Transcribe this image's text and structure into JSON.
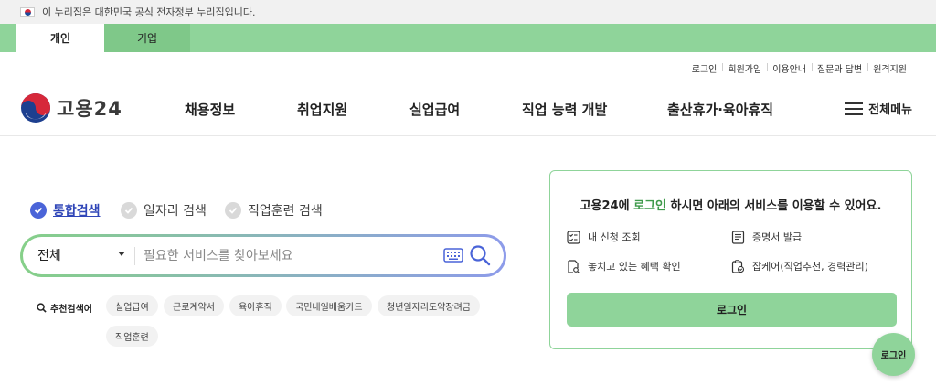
{
  "gov_banner": {
    "text": "이 누리집은 대한민국 공식 전자정부 누리집입니다."
  },
  "tabs": [
    {
      "label": "개인",
      "active": true
    },
    {
      "label": "기업",
      "active": false
    }
  ],
  "utility_links": [
    "로그인",
    "회원가입",
    "이용안내",
    "질문과 답변",
    "원격지원"
  ],
  "logo": {
    "text": "고용24"
  },
  "nav": [
    "채용정보",
    "취업지원",
    "실업급여",
    "직업 능력 개발",
    "출산휴가·육아휴직"
  ],
  "menu_all": {
    "label": "전체메뉴"
  },
  "search": {
    "types": [
      {
        "label": "통합검색",
        "selected": true
      },
      {
        "label": "일자리 검색",
        "selected": false
      },
      {
        "label": "직업훈련 검색",
        "selected": false
      }
    ],
    "scope": "전체",
    "placeholder": "필요한 서비스를 찾아보세요",
    "recommended_label": "추천검색어",
    "recommended": [
      "실업급여",
      "근로계약서",
      "육아휴직",
      "국민내일배움카드",
      "청년일자리도약장려금",
      "직업훈련"
    ]
  },
  "login_card": {
    "msg_prefix": "고용24에 ",
    "msg_highlight": "로그인",
    "msg_suffix": " 하시면 아래의 서비스를 이용할 수 있어요.",
    "services": [
      "내 신청 조회",
      "증명서 발급",
      "놓치고 있는 혜택 확인",
      "잡케어(직업추천, 경력관리)"
    ],
    "button": "로그인"
  },
  "floating_button": "로그인",
  "colors": {
    "accent_green": "#8fd49a",
    "accent_blue": "#4a64d8",
    "highlight_green": "#3f9a4b"
  }
}
